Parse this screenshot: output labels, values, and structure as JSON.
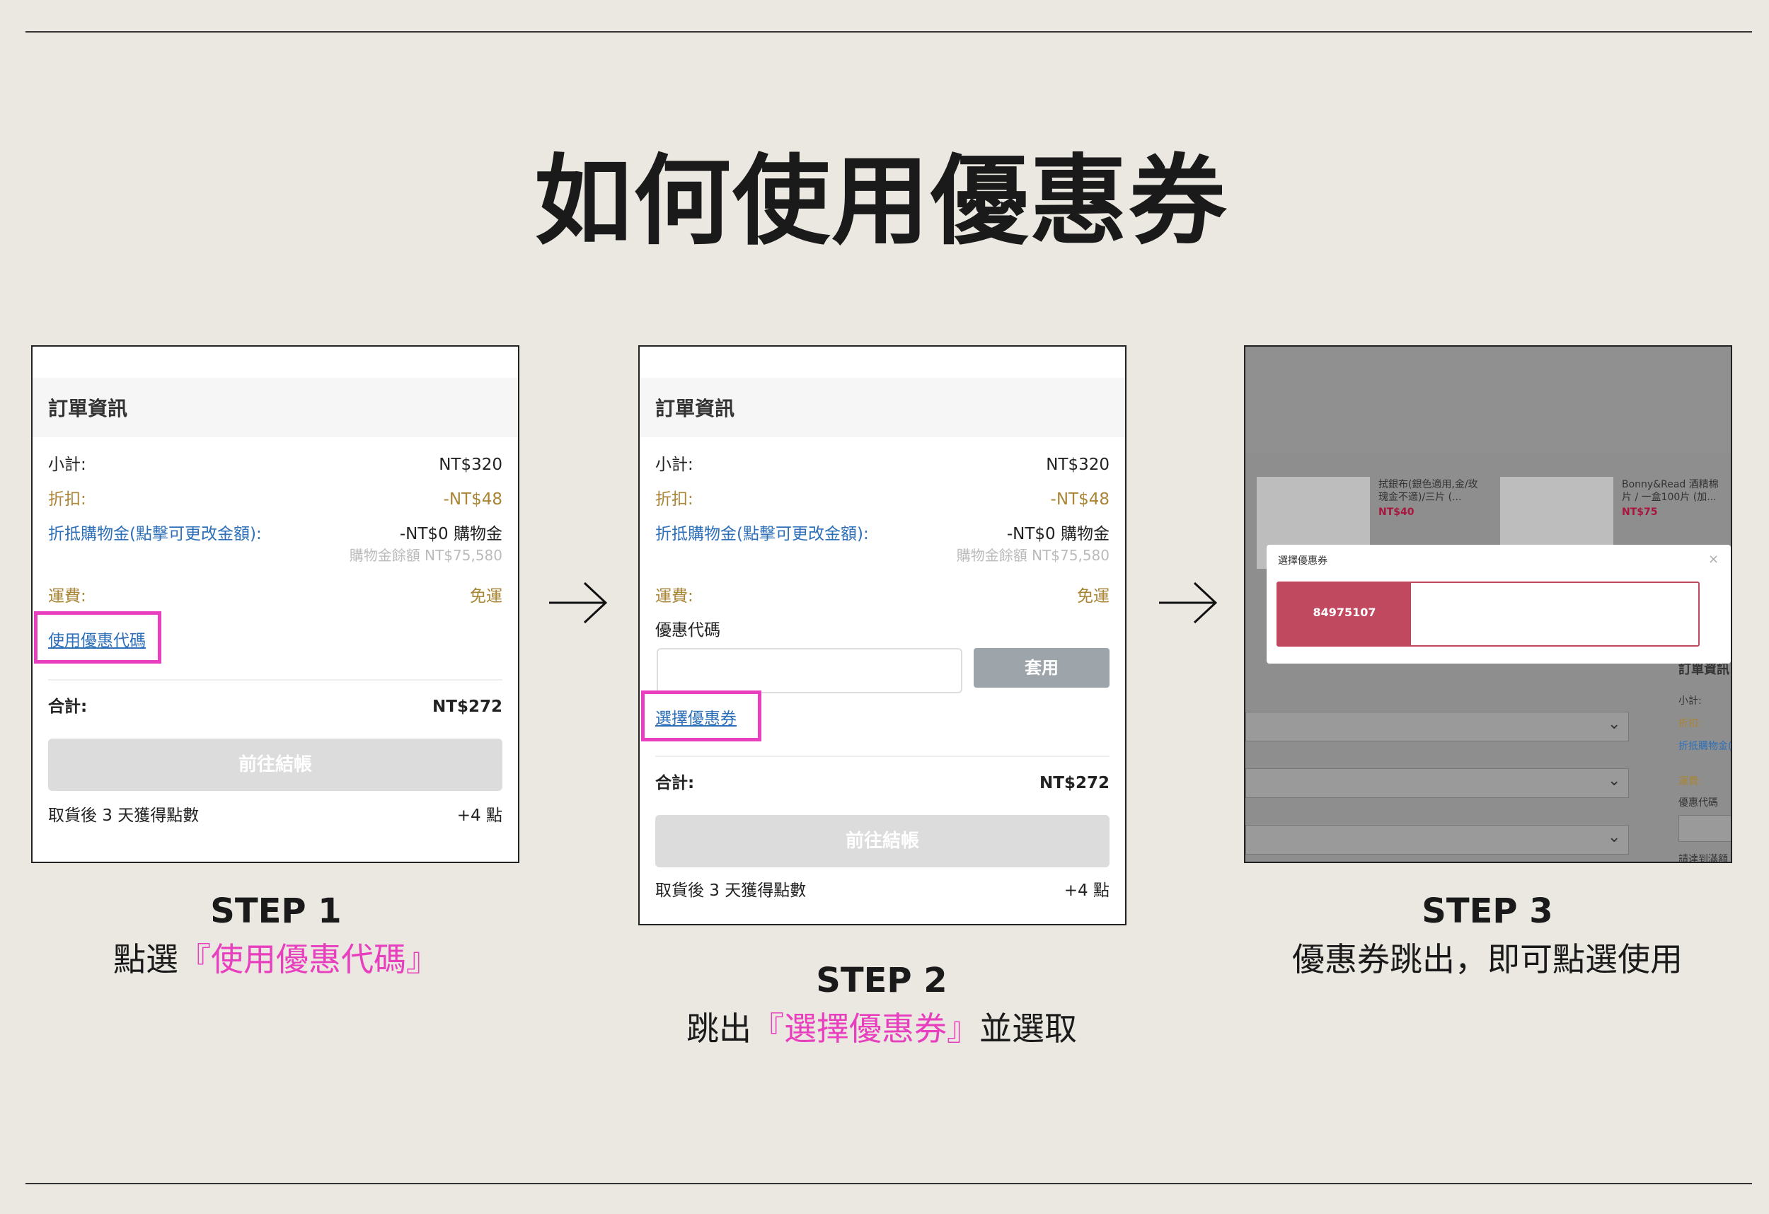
{
  "title": "如何使用優惠券",
  "order": {
    "header": "訂單資訊",
    "subtotal_label": "小計:",
    "subtotal_value": "NT$320",
    "discount_label": "折扣:",
    "discount_value": "-NT$48",
    "credit_label": "折抵購物金(點擊可更改金額):",
    "credit_value": "-NT$0 購物金",
    "credit_balance": "購物金餘額 NT$75,580",
    "shipping_label": "運費:",
    "shipping_value": "免運",
    "use_coupon_link": "使用優惠代碼",
    "coupon_field_label": "優惠代碼",
    "apply_button": "套用",
    "select_coupon_link": "選擇優惠券",
    "total_label": "合計:",
    "total_value": "NT$272",
    "checkout_button": "前往結帳",
    "points_label": "取貨後 3 天獲得點數",
    "points_value": "+4 點"
  },
  "step3": {
    "product1_name": "拭銀布(銀色適用,金/玫瑰金不適)/三片 (...",
    "product1_price": "NT$40",
    "product2_name": "Bonny&Read 酒精棉片 / 一盒100片 (加...",
    "product2_price": "NT$75",
    "modal_title": "選擇優惠券",
    "modal_close": "×",
    "coupon_code": "84975107",
    "side_header": "訂單資訊",
    "side_subtotal": "小計:",
    "side_discount": "折扣:",
    "side_credit": "折抵購物金(",
    "side_shipping": "運費:",
    "side_coupon": "優惠代碼",
    "side_hint": "請達到滿額"
  },
  "steps": [
    {
      "title": "STEP 1",
      "desc_prefix": "點選",
      "desc_highlight": "『使用優惠代碼』",
      "desc_suffix": ""
    },
    {
      "title": "STEP 2",
      "desc_prefix": "跳出",
      "desc_highlight": "『選擇優惠券』",
      "desc_suffix": "並選取"
    },
    {
      "title": "STEP 3",
      "desc_prefix": "優惠券跳出，即可點選使用",
      "desc_highlight": "",
      "desc_suffix": ""
    }
  ],
  "icons": {
    "arrow": "arrow-right-icon",
    "chevron": "chevron-down-icon"
  },
  "colors": {
    "highlight": "#e83fbe",
    "coupon": "#c0485f",
    "link": "#2d6fb8",
    "gold": "#a98535"
  }
}
